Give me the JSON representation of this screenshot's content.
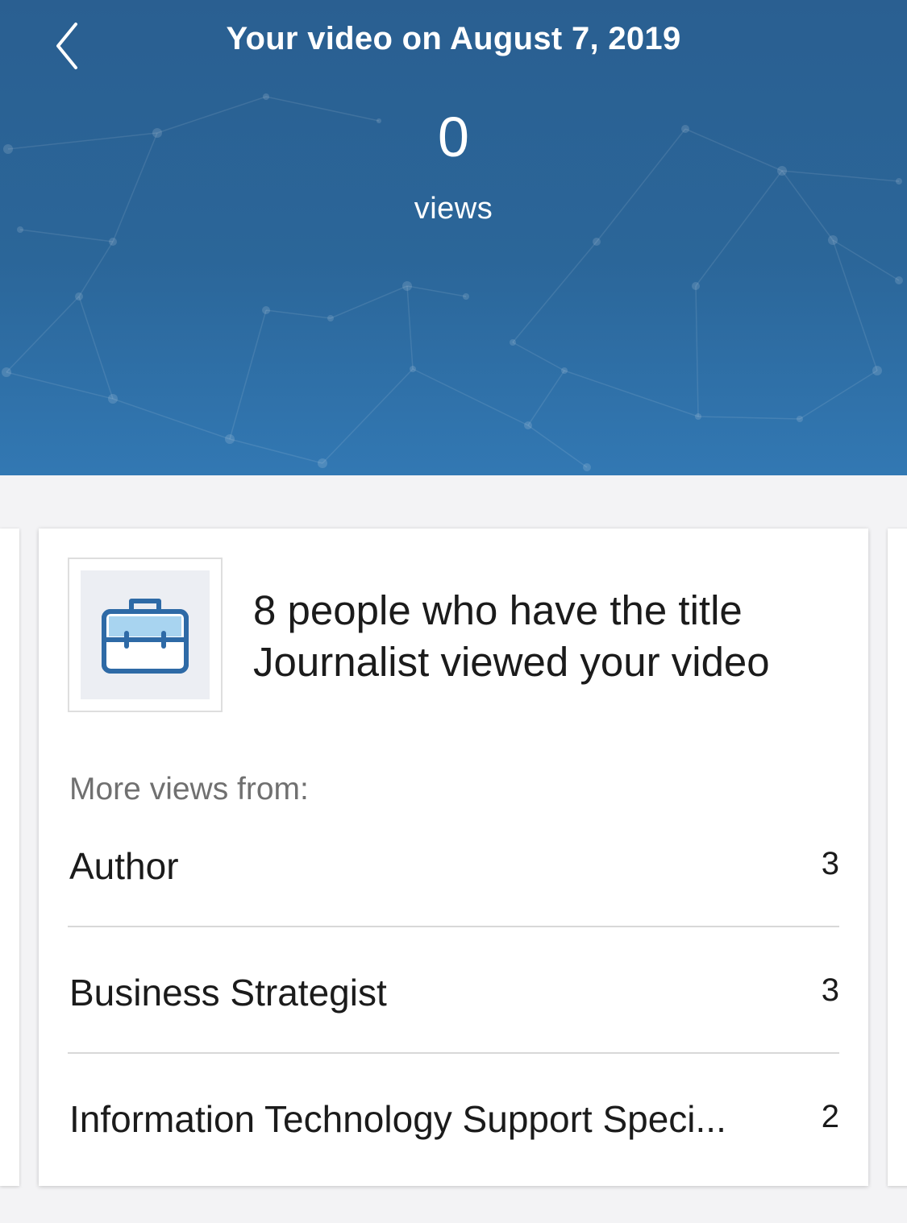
{
  "header": {
    "title": "Your video on August 7, 2019",
    "view_count": "0",
    "view_label": "views",
    "back_icon": "chevron-left-icon",
    "background_color": "#2b6699"
  },
  "card": {
    "icon": "briefcase-icon",
    "headline_line1": "8 people who have the title",
    "headline_line2": "Journalist viewed your video",
    "more_views_label": "More views from:",
    "rows": [
      {
        "label": "Author",
        "count": "3"
      },
      {
        "label": "Business Strategist",
        "count": "3"
      },
      {
        "label": "Information Technology Support Speci...",
        "count": "2"
      }
    ]
  },
  "colors": {
    "header_blue": "#2b6699",
    "icon_blue": "#2e6aa6",
    "icon_fill": "#a8d4f0",
    "page_bg": "#f3f3f5"
  }
}
